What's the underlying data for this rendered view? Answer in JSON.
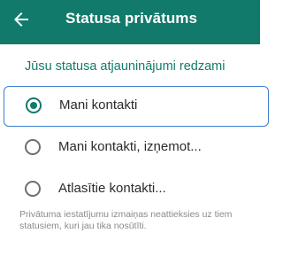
{
  "header": {
    "title": "Statusa privātums",
    "back_icon": "arrow-left-icon",
    "color": "#127a6b"
  },
  "section_header": "Jūsu statusa atjauninājumi redzami",
  "options": [
    {
      "label": "Mani kontakti",
      "selected": true
    },
    {
      "label": "Mani kontakti, izņemot...",
      "selected": false
    },
    {
      "label": "Atlasītie kontakti...",
      "selected": false
    }
  ],
  "footnote": "Privātuma iestatījumu izmaiņas neattieksies uz tiem statusiem, kuri jau tika nosūtīti.",
  "colors": {
    "accent": "#127a6b",
    "focus_outline": "#3b7fd0"
  }
}
